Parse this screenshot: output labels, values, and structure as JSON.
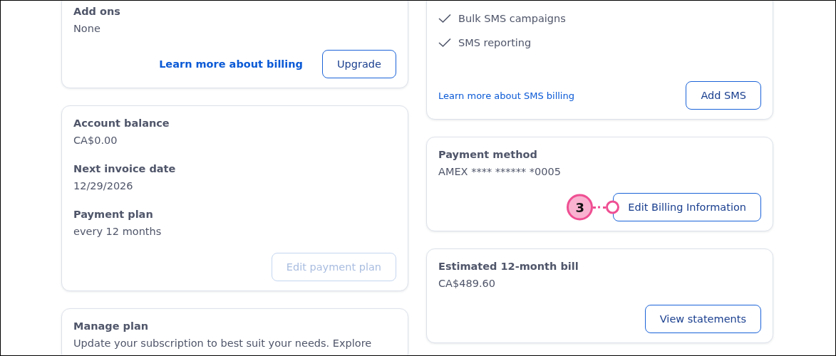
{
  "columns": [
    {
      "cards": [
        {
          "fields": [
            {
              "label": "Add ons",
              "value": "None"
            }
          ],
          "link": {
            "label": "Learn more about billing",
            "kind": "bold"
          },
          "button": {
            "label": "Upgrade",
            "disabled": false
          }
        },
        {
          "fields": [
            {
              "label": "Account balance",
              "value": "CA$0.00"
            },
            {
              "label": "Next invoice date",
              "value": "12/29/2026"
            },
            {
              "label": "Payment plan",
              "value": "every 12 months"
            }
          ],
          "button": {
            "label": "Edit payment plan",
            "disabled": true
          }
        },
        {
          "fields": [
            {
              "label": "Manage plan",
              "value": "Update your subscription to best suit your needs. Explore"
            }
          ]
        }
      ]
    },
    {
      "cards": [
        {
          "features": [
            {
              "label": "Bulk SMS campaigns",
              "checked": true
            },
            {
              "label": "SMS reporting",
              "checked": true
            }
          ],
          "link": {
            "label": "Learn more about SMS billing",
            "kind": "small"
          },
          "button": {
            "label": "Add SMS",
            "disabled": false
          }
        },
        {
          "fields": [
            {
              "label": "Payment method",
              "value": "AMEX **** ****** *0005"
            }
          ],
          "button": {
            "label": "Edit Billing Information",
            "disabled": false
          },
          "callout": {
            "number": "3"
          }
        },
        {
          "fields": [
            {
              "label": "Estimated 12-month bill",
              "value": "CA$489.60"
            }
          ],
          "button": {
            "label": "View statements",
            "disabled": false
          }
        }
      ]
    }
  ]
}
